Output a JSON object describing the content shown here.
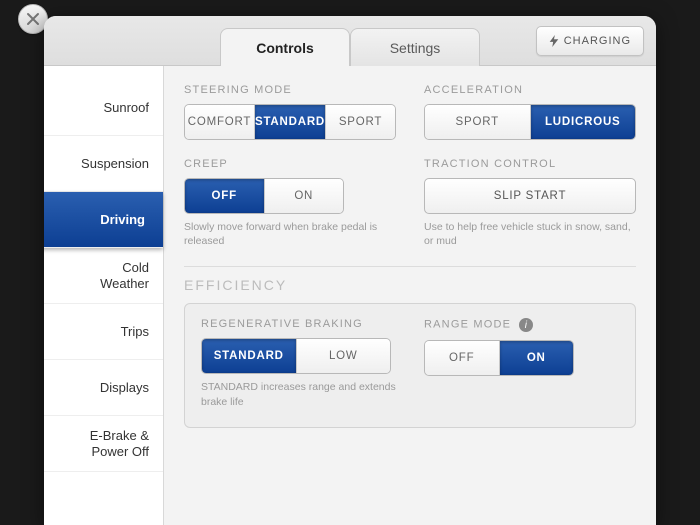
{
  "close": {
    "label": "Close"
  },
  "tabs": {
    "controls": "Controls",
    "settings": "Settings",
    "active": "controls"
  },
  "charging_button": "CHARGING",
  "sidebar": {
    "items": [
      {
        "label": "Sunroof",
        "key": "sunroof"
      },
      {
        "label": "Suspension",
        "key": "suspension"
      },
      {
        "label": "Driving",
        "key": "driving"
      },
      {
        "label": "Cold\nWeather",
        "key": "cold-weather"
      },
      {
        "label": "Trips",
        "key": "trips"
      },
      {
        "label": "Displays",
        "key": "displays"
      },
      {
        "label": "E-Brake &\nPower Off",
        "key": "ebrake"
      }
    ],
    "active": "driving"
  },
  "driving": {
    "steering": {
      "label": "STEERING MODE",
      "options": [
        "COMFORT",
        "STANDARD",
        "SPORT"
      ],
      "selected": "STANDARD"
    },
    "acceleration": {
      "label": "ACCELERATION",
      "options": [
        "SPORT",
        "LUDICROUS"
      ],
      "selected": "LUDICROUS"
    },
    "creep": {
      "label": "CREEP",
      "options": [
        "OFF",
        "ON"
      ],
      "selected": "OFF",
      "hint": "Slowly move forward when brake pedal is released"
    },
    "traction": {
      "label": "TRACTION CONTROL",
      "button": "SLIP START",
      "hint": "Use to help free vehicle stuck in snow, sand, or mud"
    },
    "efficiency": {
      "title": "EFFICIENCY",
      "regen": {
        "label": "REGENERATIVE BRAKING",
        "options": [
          "STANDARD",
          "LOW"
        ],
        "selected": "STANDARD",
        "hint": "STANDARD increases range and extends brake life"
      },
      "range_mode": {
        "label": "RANGE MODE",
        "options": [
          "OFF",
          "ON"
        ],
        "selected": "ON"
      }
    }
  }
}
